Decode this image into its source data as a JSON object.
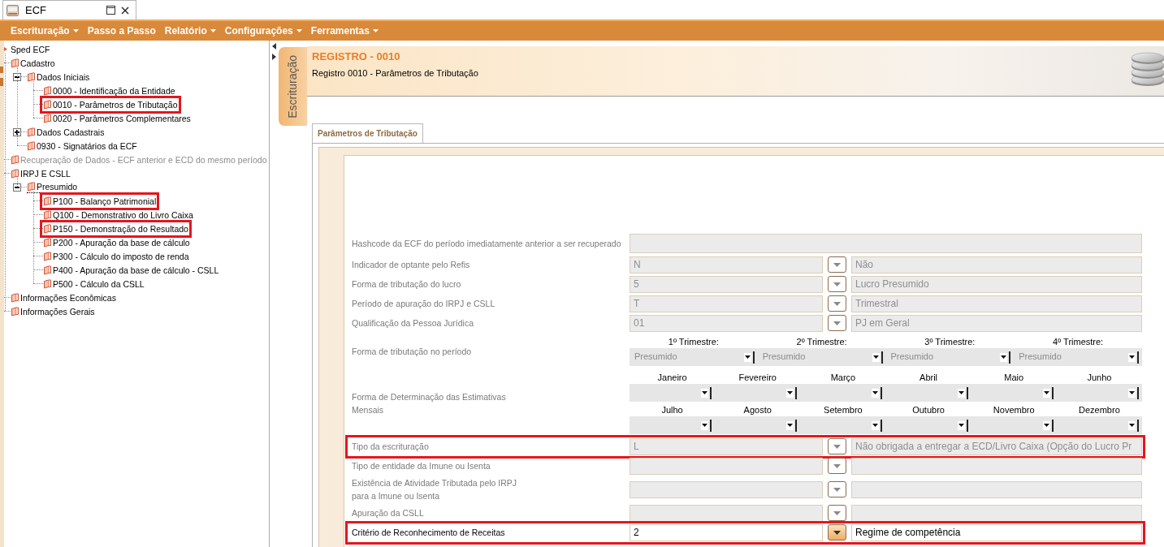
{
  "window": {
    "tab_title": "ECF"
  },
  "menu": [
    {
      "label": "Escrituração",
      "dropdown": true
    },
    {
      "label": "Passo a Passo",
      "dropdown": false
    },
    {
      "label": "Relatório",
      "dropdown": true
    },
    {
      "label": "Configurações",
      "dropdown": true
    },
    {
      "label": "Ferramentas",
      "dropdown": true
    }
  ],
  "tree": [
    {
      "label": "Sped ECF",
      "selected": false,
      "children": [
        {
          "label": "Cadastro",
          "selected": false,
          "disabled": false,
          "highlighted": false,
          "children": [
            {
              "label": "Dados Iniciais",
              "expanded": true,
              "selected": false,
              "highlighted": false,
              "children": [
                {
                  "label": "0000 - Identificação da Entidade",
                  "selected": false,
                  "highlighted": false
                },
                {
                  "label": "0010 - Parâmetros de Tributação",
                  "selected": false,
                  "highlighted": true
                },
                {
                  "label": "0020 - Parâmetros Complementares",
                  "selected": false,
                  "highlighted": false
                }
              ]
            },
            {
              "label": "Dados Cadastrais",
              "expanded": false,
              "selected": false,
              "highlighted": false
            },
            {
              "label": "0930 - Signatários da ECF",
              "selected": false,
              "highlighted": false
            }
          ]
        },
        {
          "label": "Recuperação de Dados - ECF anterior e ECD do mesmo período",
          "selected": false,
          "disabled": true,
          "highlighted": false
        },
        {
          "label": "IRPJ E CSLL",
          "selected": false,
          "disabled": false,
          "highlighted": false,
          "children": [
            {
              "label": "Presumido",
              "expanded": true,
              "selected": true,
              "highlighted": false,
              "children": [
                {
                  "label": "P100 - Balanço Patrimonial",
                  "selected": false,
                  "highlighted": true
                },
                {
                  "label": "Q100 - Demonstrativo do Livro Caixa",
                  "selected": false,
                  "highlighted": false
                },
                {
                  "label": "P150 - Demonstração do Resultado",
                  "selected": false,
                  "highlighted": true
                },
                {
                  "label": "P200 - Apuração da base de cálculo",
                  "selected": false,
                  "highlighted": false
                },
                {
                  "label": "P300 - Cálculo do imposto de renda",
                  "selected": false,
                  "highlighted": false
                },
                {
                  "label": "P400 - Apuração da base de cálculo - CSLL",
                  "selected": false,
                  "highlighted": false
                },
                {
                  "label": "P500 - Cálculo da CSLL",
                  "selected": false,
                  "highlighted": false
                }
              ]
            }
          ]
        },
        {
          "label": "Informações Econômicas",
          "selected": false,
          "disabled": false,
          "highlighted": false
        },
        {
          "label": "Informações Gerais",
          "selected": false,
          "disabled": false,
          "highlighted": false
        }
      ]
    }
  ],
  "side_tab": {
    "label": "Escrituração",
    "selected": true
  },
  "header": {
    "title": "REGISTRO - 0010",
    "subtitle": "Registro 0010 - Parâmetros de Tributação"
  },
  "tabs": [
    {
      "label": "Parâmetros de Tributação",
      "selected": true
    }
  ],
  "form": {
    "rows": [
      {
        "kind": "text",
        "label": "Hashcode da ECF do período imediatamente anterior a ser recuperado",
        "disabled": true,
        "highlighted": false
      },
      {
        "kind": "lookup",
        "label": "Indicador de optante pelo Refis",
        "code": "N",
        "description": "Não",
        "disabled": true,
        "highlighted": false
      },
      {
        "kind": "lookup",
        "label": "Forma de tributação do lucro",
        "code": "5",
        "description": "Lucro Presumido",
        "disabled": true,
        "highlighted": false
      },
      {
        "kind": "lookup",
        "label": "Período de apuração do IRPJ e CSLL",
        "code": "T",
        "description": "Trimestral",
        "disabled": true,
        "highlighted": false
      },
      {
        "kind": "lookup",
        "label": "Qualificação da Pessoa Jurídica",
        "code": "01",
        "description": "PJ em Geral",
        "disabled": true,
        "highlighted": false
      },
      {
        "kind": "quarters",
        "label": "Forma de tributação no período",
        "disabled": true,
        "highlighted": false,
        "columns": [
          {
            "heading": "1º Trimestre:",
            "value": "Presumido"
          },
          {
            "heading": "2º Trimestre:",
            "value": "Presumido"
          },
          {
            "heading": "3º Trimestre:",
            "value": "Presumido"
          },
          {
            "heading": "4º Trimestre:",
            "value": "Presumido"
          }
        ]
      },
      {
        "kind": "months",
        "label": "Forma de Determinação das Estimativas\nMensais",
        "disabled": true,
        "highlighted": false,
        "lines": [
          {
            "columns": [
              {
                "heading": "Janeiro"
              },
              {
                "heading": "Fevereiro"
              },
              {
                "heading": "Março"
              },
              {
                "heading": "Abril"
              },
              {
                "heading": "Maio"
              },
              {
                "heading": "Junho"
              }
            ]
          },
          {
            "columns": [
              {
                "heading": "Julho"
              },
              {
                "heading": "Agosto"
              },
              {
                "heading": "Setembro"
              },
              {
                "heading": "Outubro"
              },
              {
                "heading": "Novembro"
              },
              {
                "heading": "Dezembro"
              }
            ]
          }
        ]
      },
      {
        "kind": "lookup",
        "label": "Tipo da escrituração",
        "code": "L",
        "description": "Não obrigada a entregar a ECD/Livro Caixa (Opção do Lucro Pr",
        "disabled": true,
        "highlighted": true
      },
      {
        "kind": "lookup",
        "label": "Tipo de entidade da Imune ou Isenta",
        "disabled": true,
        "highlighted": false
      },
      {
        "kind": "lookup",
        "label": "Existência de Atividade Tributada pelo IRPJ\npara a Imune ou Isenta",
        "disabled": true,
        "highlighted": false
      },
      {
        "kind": "lookup",
        "label": "Apuração da CSLL",
        "disabled": true,
        "highlighted": false
      },
      {
        "kind": "lookup",
        "label": "Critério de Reconhecimento de Receitas",
        "code": "2",
        "description": "Regime de competência",
        "disabled": false,
        "highlighted": true
      }
    ]
  }
}
